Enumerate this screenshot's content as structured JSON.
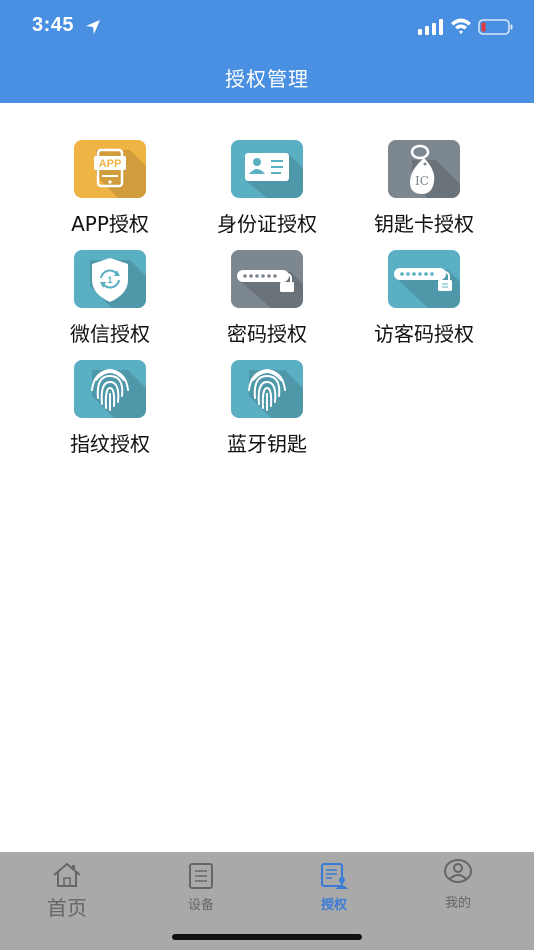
{
  "status": {
    "time": "3:45"
  },
  "header": {
    "title": "授权管理"
  },
  "tiles": [
    {
      "label": "APP授权",
      "icon": "app-icon",
      "color": "#f0b445"
    },
    {
      "label": "身份证授权",
      "icon": "id-card-icon",
      "color": "#5aafc3"
    },
    {
      "label": "钥匙卡授权",
      "icon": "ic-keyfob-icon",
      "color": "#7d8790"
    },
    {
      "label": "微信授权",
      "icon": "wechat-shield-icon",
      "color": "#5aafc3"
    },
    {
      "label": "密码授权",
      "icon": "password-lock-icon",
      "color": "#7d8790"
    },
    {
      "label": "访客码授权",
      "icon": "visitor-code-icon",
      "color": "#5aafc3"
    },
    {
      "label": "指纹授权",
      "icon": "fingerprint-icon",
      "color": "#5aafc3"
    },
    {
      "label": "蓝牙钥匙",
      "icon": "bluetooth-fingerprint-icon",
      "color": "#5aafc3"
    }
  ],
  "tabbar": {
    "home": "首页",
    "devices": "设备",
    "auth": "授权",
    "mine": "我的",
    "active_color": "#3a7bd5"
  }
}
